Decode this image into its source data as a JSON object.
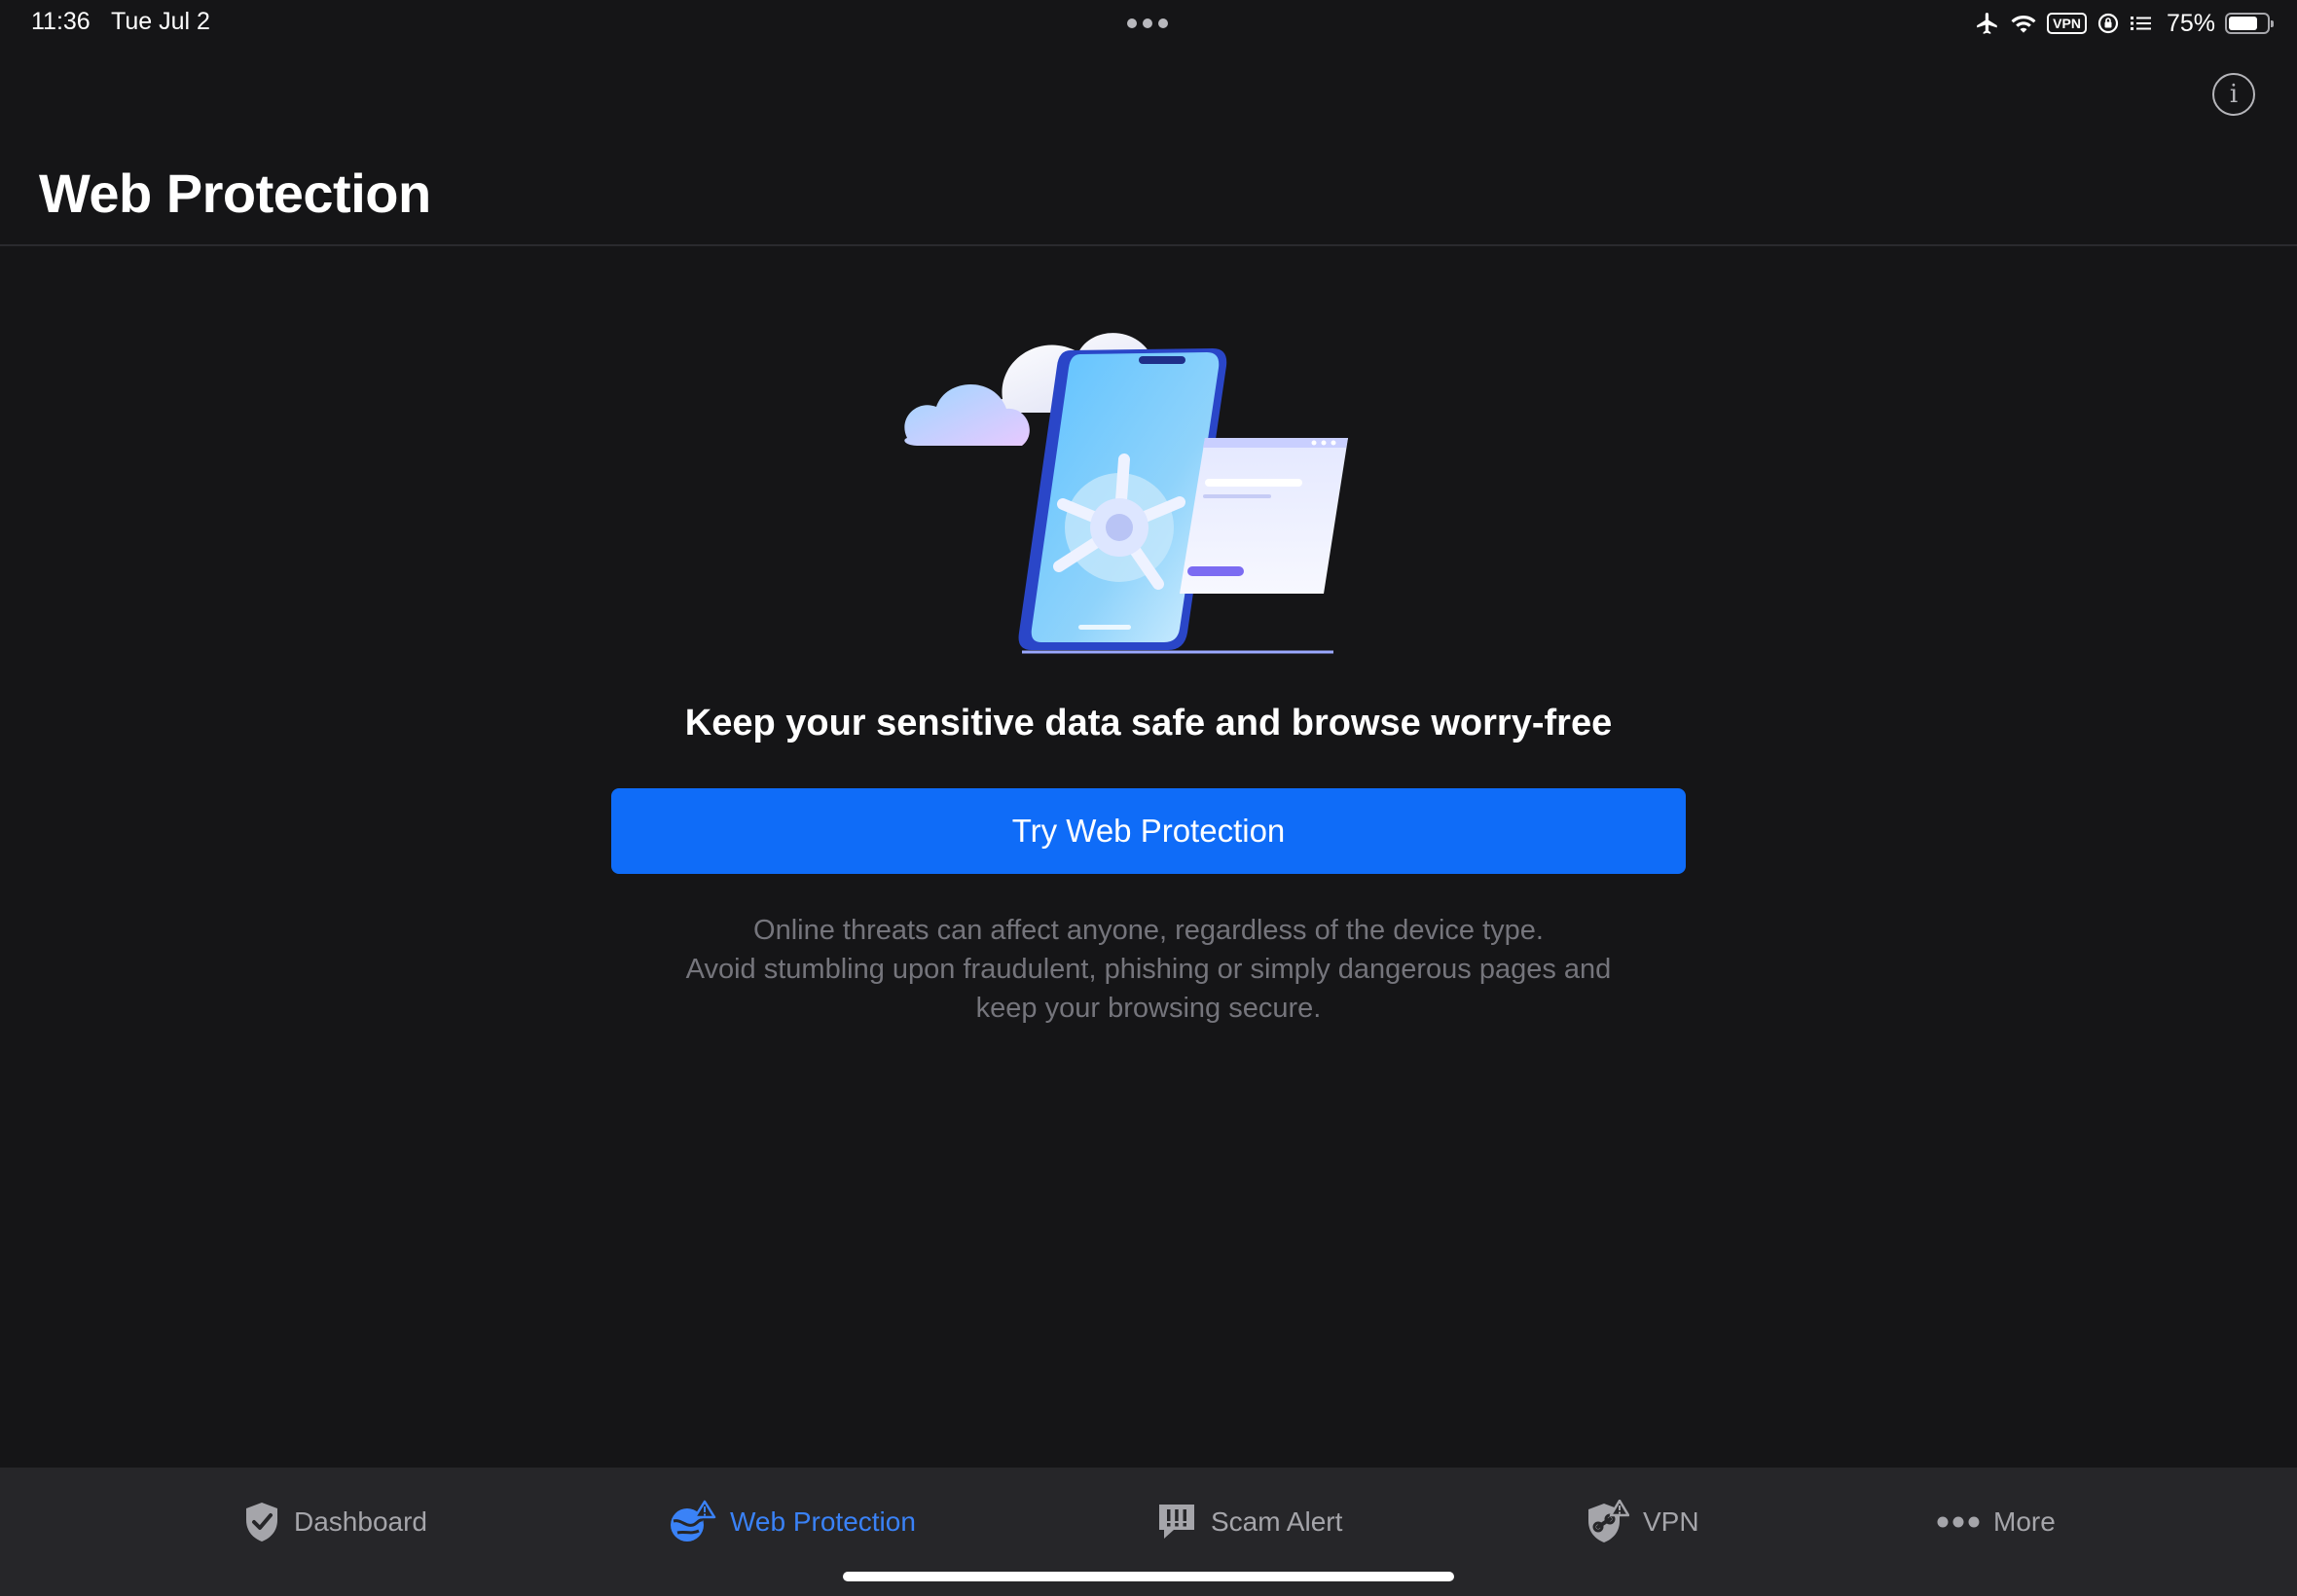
{
  "status_bar": {
    "time": "11:36",
    "date": "Tue Jul 2",
    "vpn_badge": "VPN",
    "battery_percent": "75%",
    "battery_level": 0.75,
    "icons": [
      "airplane-icon",
      "wifi-icon",
      "vpn-badge",
      "rotation-lock-icon",
      "list-icon",
      "battery-icon"
    ]
  },
  "header": {
    "title": "Web Protection",
    "info_icon": "info-icon"
  },
  "main": {
    "tagline": "Keep your sensitive data safe and browse worry-free",
    "cta_label": "Try Web Protection",
    "description_lines": [
      "Online threats can affect anyone, regardless of the device type.",
      "Avoid stumbling upon fraudulent, phishing or simply dangerous pages and",
      "keep your browsing secure."
    ]
  },
  "tab_bar": {
    "tabs": [
      {
        "label": "Dashboard",
        "icon": "shield-check-icon",
        "active": false
      },
      {
        "label": "Web Protection",
        "icon": "globe-alert-icon",
        "active": true
      },
      {
        "label": "Scam Alert",
        "icon": "chat-alert-icon",
        "active": false
      },
      {
        "label": "VPN",
        "icon": "shield-link-icon",
        "active": false
      },
      {
        "label": "More",
        "icon": "more-dots-icon",
        "active": false
      }
    ]
  },
  "colors": {
    "background": "#151517",
    "accent": "#0f6cf8",
    "active_tab": "#3a82f7",
    "inactive_tab": "#a5a5aa",
    "tab_bar_bg": "#262629",
    "description_text": "#75757c"
  }
}
